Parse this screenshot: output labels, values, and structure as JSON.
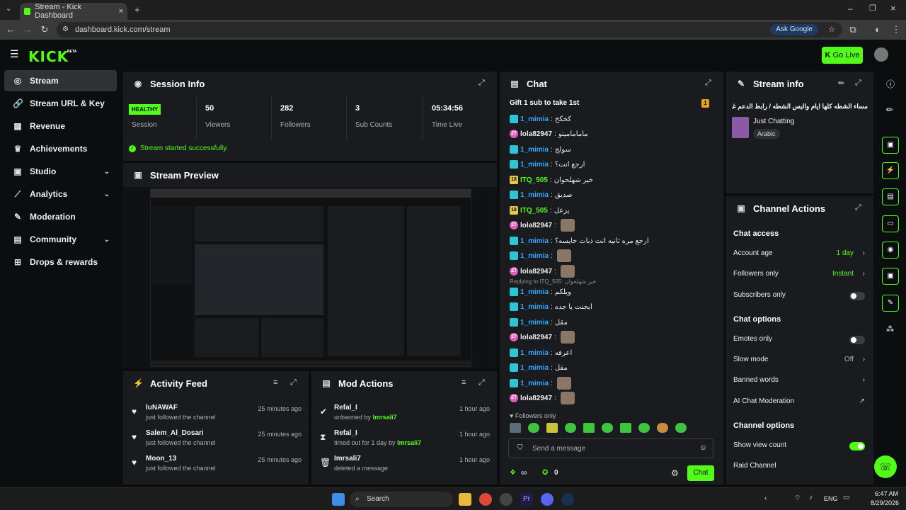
{
  "browser": {
    "tab_title": "Stream - Kick Dashboard",
    "url": "dashboard.kick.com/stream",
    "ask_google": "Ask Google"
  },
  "app": {
    "logo": "KICK",
    "logo_tag": "BETA",
    "go_live": "Go Live"
  },
  "sidebar": {
    "items": [
      {
        "label": "Stream",
        "icon": "stream-icon"
      },
      {
        "label": "Stream URL & Key",
        "icon": "link-icon"
      },
      {
        "label": "Revenue",
        "icon": "revenue-icon"
      },
      {
        "label": "Achievements",
        "icon": "trophy-icon"
      },
      {
        "label": "Studio",
        "icon": "studio-icon"
      },
      {
        "label": "Analytics",
        "icon": "analytics-icon"
      },
      {
        "label": "Moderation",
        "icon": "wrench-icon"
      },
      {
        "label": "Community",
        "icon": "community-icon"
      },
      {
        "label": "Drops & rewards",
        "icon": "gift-icon"
      }
    ]
  },
  "session": {
    "title": "Session Info",
    "health": "HEALTHY",
    "health_label": "Session",
    "stats": [
      {
        "value": "50",
        "label": "Viewers"
      },
      {
        "value": "282",
        "label": "Followers"
      },
      {
        "value": "3",
        "label": "Sub Counts"
      },
      {
        "value": "05:34:56",
        "label": "Time Live"
      }
    ],
    "status_msg": "Stream started successfully."
  },
  "preview": {
    "title": "Stream Preview"
  },
  "activity": {
    "title": "Activity Feed",
    "rows": [
      {
        "name": "luNAWAF",
        "sub": "just followed the channel",
        "time": "25 minutes ago"
      },
      {
        "name": "Salem_Al_Dosari",
        "sub": "just followed the channel",
        "time": "25 minutes ago"
      },
      {
        "name": "Moon_13",
        "sub": "just followed the channel",
        "time": "25 minutes ago"
      }
    ]
  },
  "mod": {
    "title": "Mod Actions",
    "rows": [
      {
        "name": "Refal_I",
        "sub_pre": "unbanned by",
        "sub_user": "Imrsali7",
        "sub_post": "",
        "time": "1 hour ago"
      },
      {
        "name": "Refal_I",
        "sub_pre": "timed out for 1 day by",
        "sub_user": "Imrsali7",
        "sub_post": "",
        "time": "1 hour ago"
      },
      {
        "name": "Imrsali7",
        "sub_pre": "deleted a message",
        "sub_user": "",
        "sub_post": "",
        "time": "1 hour ago"
      }
    ]
  },
  "chat": {
    "title": "Chat",
    "pinned": "Gift 1 sub to take 1st",
    "pinned_count": "1",
    "messages": [
      {
        "user": "1_mimia",
        "color": "blue",
        "badge": "b",
        "text": "كخكخ"
      },
      {
        "user": "lola82947",
        "color": "white",
        "badge": "p",
        "text": "ماماماميتو"
      },
      {
        "user": "1_mimia",
        "color": "blue",
        "badge": "b",
        "text": "سولج"
      },
      {
        "user": "1_mimia",
        "color": "blue",
        "badge": "b",
        "text": "ارجع انت؟"
      },
      {
        "user": "ITQ_505",
        "color": "green",
        "badge": "g",
        "text": "خير شهلحوان"
      },
      {
        "user": "1_mimia",
        "color": "blue",
        "badge": "b",
        "text": "صديق"
      },
      {
        "user": "ITQ_505",
        "color": "green",
        "badge": "g",
        "text": "يزعل"
      },
      {
        "user": "lola82947",
        "color": "white",
        "badge": "p",
        "text": ""
      },
      {
        "user": "1_mimia",
        "color": "blue",
        "badge": "b",
        "text": "ارجع مره ثانيه انت ذبات خايسه؟"
      },
      {
        "user": "1_mimia",
        "color": "blue",
        "badge": "b",
        "text": ""
      },
      {
        "user": "lola82947",
        "color": "white",
        "badge": "p",
        "text": ""
      },
      {
        "user": "1_mimia",
        "color": "blue",
        "badge": "b",
        "text": "ويلكم"
      },
      {
        "user": "1_mimia",
        "color": "blue",
        "badge": "b",
        "text": "ايجنت يا جده"
      },
      {
        "user": "1_mimia",
        "color": "blue",
        "badge": "b",
        "text": "مقل"
      },
      {
        "user": "lola82947",
        "color": "white",
        "badge": "p",
        "text": ""
      },
      {
        "user": "1_mimia",
        "color": "blue",
        "badge": "b",
        "text": "اعرفه"
      },
      {
        "user": "1_mimia",
        "color": "blue",
        "badge": "b",
        "text": "مقل"
      },
      {
        "user": "1_mimia",
        "color": "blue",
        "badge": "b",
        "text": ""
      },
      {
        "user": "lola82947",
        "color": "white",
        "badge": "p",
        "text": ""
      }
    ],
    "reply_note": "Replying to ITQ_505: خير شهلحوان",
    "followers_only": "Followers only",
    "input_placeholder": "Send a message",
    "count_a": "0",
    "send_label": "Chat"
  },
  "stream_info": {
    "title": "Stream info",
    "stream_title": "مساء الشطه كلها ايام والبس الشطه / رابط الدعم غريفان",
    "category": "Just Chatting",
    "language": "Arabic"
  },
  "channel_actions": {
    "title": "Channel Actions",
    "chat_access": "Chat access",
    "account_age": "Account age",
    "account_age_val": "1 day",
    "followers_only": "Followers only",
    "followers_only_val": "Instant",
    "subs_only": "Subscribers only",
    "chat_options": "Chat options",
    "emotes_only": "Emotes only",
    "slow_mode": "Slow mode",
    "slow_mode_val": "Off",
    "banned_words": "Banned words",
    "ai_mod": "AI Chat Moderation",
    "channel_options": "Channel options",
    "show_view_count": "Show view count",
    "raid_channel": "Raid Channel"
  },
  "taskbar": {
    "search": "Search",
    "lang": "ENG",
    "time": "6:47 AM",
    "date": "8/29/2026"
  },
  "colors": {
    "accent": "#53fc18",
    "panel": "#191b1f",
    "bg": "#0b0e0f"
  }
}
